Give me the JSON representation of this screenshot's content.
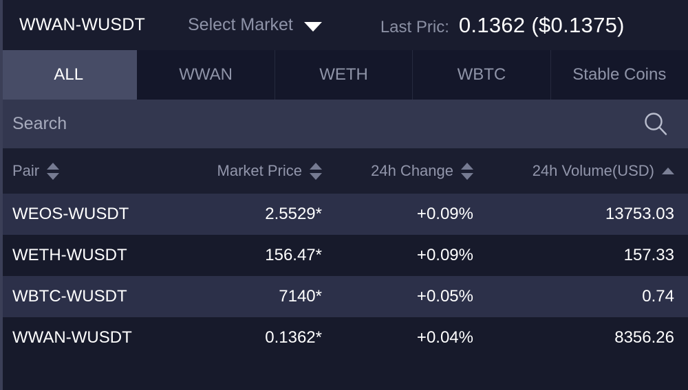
{
  "header": {
    "pair": "WWAN-WUSDT",
    "select_market_label": "Select Market",
    "caret_icon": "chevron-down-icon",
    "last_price_label": "Last Pric:",
    "last_price_value": "0.1362 ($0.1375)"
  },
  "tabs": [
    {
      "label": "ALL",
      "active": true
    },
    {
      "label": "WWAN",
      "active": false
    },
    {
      "label": "WETH",
      "active": false
    },
    {
      "label": "WBTC",
      "active": false
    },
    {
      "label": "Stable Coins",
      "active": false
    }
  ],
  "search": {
    "value": "",
    "placeholder": "Search",
    "icon": "search-icon"
  },
  "table": {
    "columns": [
      {
        "label": "Pair",
        "sort": "both"
      },
      {
        "label": "Market Price",
        "sort": "both"
      },
      {
        "label": "24h Change",
        "sort": "both"
      },
      {
        "label": "24h Volume(USD)",
        "sort": "asc"
      }
    ],
    "rows": [
      {
        "pair": "WEOS-WUSDT",
        "price": "2.5529*",
        "change": "+0.09%",
        "volume": "13753.03"
      },
      {
        "pair": "WETH-WUSDT",
        "price": "156.47*",
        "change": "+0.09%",
        "volume": "157.33"
      },
      {
        "pair": "WBTC-WUSDT",
        "price": "7140*",
        "change": "+0.05%",
        "volume": "0.74"
      },
      {
        "pair": "WWAN-WUSDT",
        "price": "0.1362*",
        "change": "+0.04%",
        "volume": "8356.26"
      }
    ]
  },
  "colors": {
    "app_bg": "#171a2b",
    "header_bg": "#191c2e",
    "tab_bg": "#14172a",
    "tab_active_bg": "#474c66",
    "tab_accent": "#3d46e0",
    "search_bg": "#33374f",
    "thead_bg": "#1b1e30",
    "row_odd_bg": "#2c3049",
    "row_even_bg": "#171a2b",
    "text_primary": "#ffffff",
    "text_muted": "#8e93a8"
  }
}
